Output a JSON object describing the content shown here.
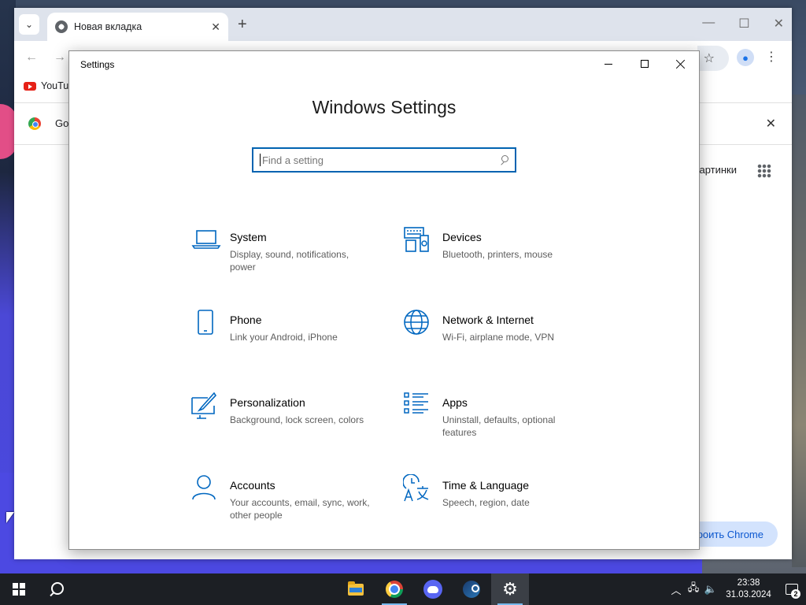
{
  "chrome": {
    "tab_title": "Новая вкладка",
    "bookmark_youtube": "YouTube",
    "infobar_text": "Go",
    "images_link": "Картинки",
    "setup_button": "Настроить Chrome"
  },
  "settings": {
    "window_title": "Settings",
    "heading": "Windows Settings",
    "search_placeholder": "Find a setting",
    "categories": [
      {
        "icon": "laptop-icon",
        "title": "System",
        "desc": "Display, sound, notifications, power"
      },
      {
        "icon": "devices-icon",
        "title": "Devices",
        "desc": "Bluetooth, printers, mouse"
      },
      {
        "icon": "phone-icon",
        "title": "Phone",
        "desc": "Link your Android, iPhone"
      },
      {
        "icon": "globe-icon",
        "title": "Network & Internet",
        "desc": "Wi-Fi, airplane mode, VPN"
      },
      {
        "icon": "paint-brush-icon",
        "title": "Personalization",
        "desc": "Background, lock screen, colors"
      },
      {
        "icon": "apps-list-icon",
        "title": "Apps",
        "desc": "Uninstall, defaults, optional features"
      },
      {
        "icon": "person-icon",
        "title": "Accounts",
        "desc": "Your accounts, email, sync, work, other people"
      },
      {
        "icon": "time-language-icon",
        "title": "Time & Language",
        "desc": "Speech, region, date"
      }
    ]
  },
  "taskbar": {
    "time": "23:38",
    "date": "31.03.2024",
    "notification_count": "2"
  },
  "colors": {
    "accent": "#0067c0",
    "taskbar": "#1c1f24"
  }
}
